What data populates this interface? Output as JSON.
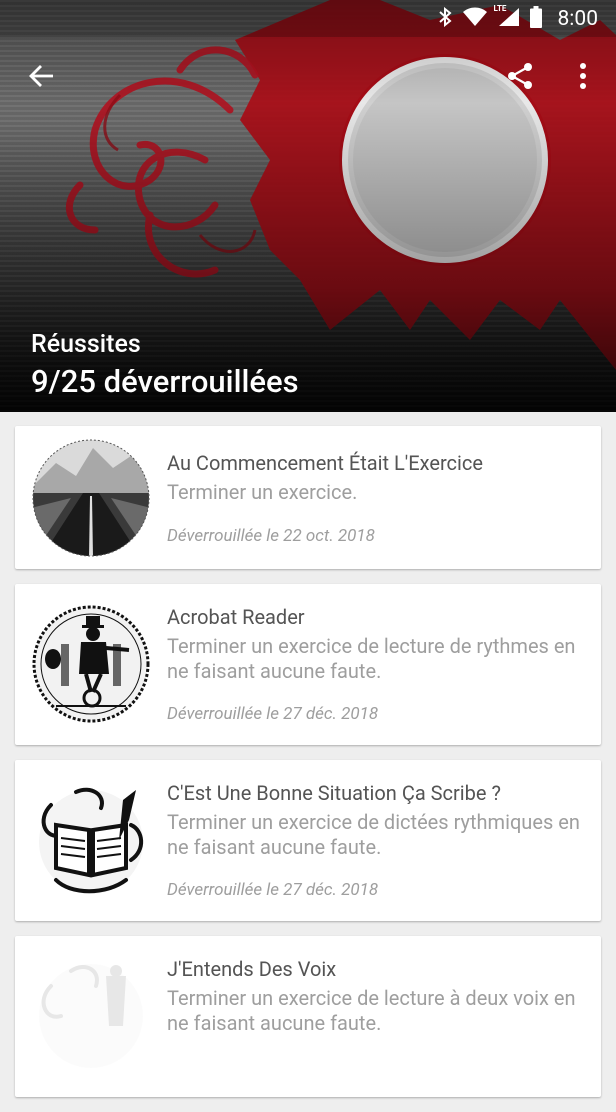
{
  "status_bar": {
    "time": "8:00",
    "network": "LTE",
    "icons": [
      "bluetooth-icon",
      "wifi-icon",
      "cell-signal-icon",
      "battery-icon"
    ]
  },
  "app_bar": {
    "back_icon": "arrow-back-icon",
    "share_icon": "share-icon",
    "menu_icon": "more-vert-icon"
  },
  "header": {
    "subtitle": "Réussites",
    "title": "9/25 déverrouillées",
    "colors": {
      "red": "#b0101a",
      "dark": "#111111"
    }
  },
  "achievements": [
    {
      "title": "Au Commencement Était L'Exercice",
      "description": "Terminer un exercice.",
      "date": "Déverrouillée le 22 oct. 2018",
      "icon": "road-mountain-badge-icon"
    },
    {
      "title": "Acrobat Reader",
      "description": "Terminer un exercice de lecture de rythmes en ne faisant aucune faute.",
      "date": "Déverrouillée le 27 déc. 2018",
      "icon": "unicycle-juggler-badge-icon"
    },
    {
      "title": "C'Est Une Bonne Situation Ça Scribe ?",
      "description": "Terminer un exercice de dictées rythmiques en ne faisant aucune faute.",
      "date": "Déverrouillée le 27 déc. 2018",
      "icon": "book-quill-badge-icon"
    },
    {
      "title": "J'Entends Des Voix",
      "description": "Terminer un exercice de lecture à deux voix en ne faisant aucune faute.",
      "date": "",
      "icon": "voices-badge-icon-locked"
    }
  ]
}
